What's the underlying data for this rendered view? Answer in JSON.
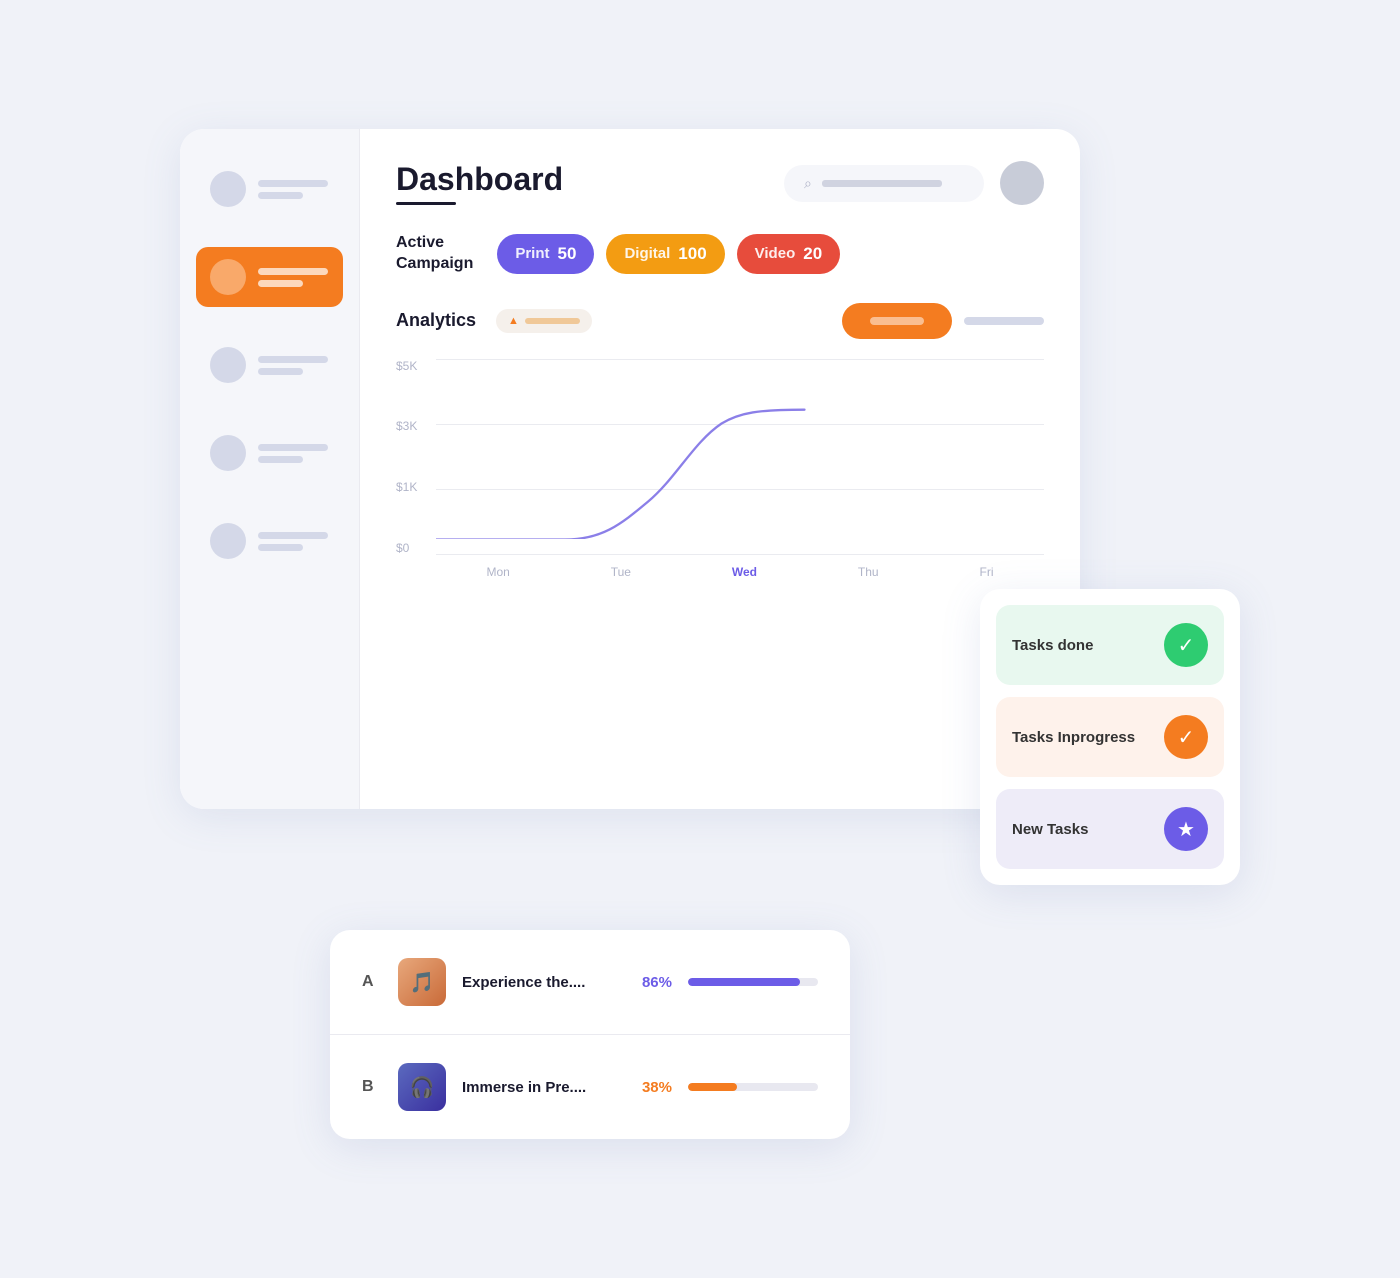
{
  "header": {
    "title": "Dashboard",
    "search_placeholder": "Search...",
    "underline": true
  },
  "sidebar": {
    "items": [
      {
        "id": "item-1",
        "active": false
      },
      {
        "id": "item-2",
        "active": true
      },
      {
        "id": "item-3",
        "active": false
      },
      {
        "id": "item-4",
        "active": false
      },
      {
        "id": "item-5",
        "active": false
      }
    ]
  },
  "campaign": {
    "label": "Active\nCampaign",
    "badges": [
      {
        "id": "print",
        "label": "Print",
        "value": "50",
        "color": "badge-print"
      },
      {
        "id": "digital",
        "label": "Digital",
        "value": "100",
        "color": "badge-digital"
      },
      {
        "id": "video",
        "label": "Video",
        "value": "20",
        "color": "badge-video"
      }
    ]
  },
  "analytics": {
    "title": "Analytics",
    "chart": {
      "y_labels": [
        "$5K",
        "$3K",
        "$1K",
        "$0"
      ],
      "x_labels": [
        "Mon",
        "Tue",
        "Wed",
        "Thu",
        "Fri"
      ],
      "active_day": "Wed"
    }
  },
  "list": {
    "items": [
      {
        "letter": "A",
        "title": "Experience the....",
        "percent": "86%",
        "percent_color": "pct-blue",
        "fill_color": "fill-blue",
        "fill_width": "86"
      },
      {
        "letter": "B",
        "title": "Immerse in Pre....",
        "percent": "38%",
        "percent_color": "pct-orange",
        "fill_color": "fill-orange",
        "fill_width": "38"
      }
    ]
  },
  "tasks": {
    "items": [
      {
        "id": "done",
        "label": "Tasks done",
        "icon": "✓",
        "icon_class": "icon-green",
        "bg": "task-item-done"
      },
      {
        "id": "inprogress",
        "label": "Tasks Inprogress",
        "icon": "✓",
        "icon_class": "icon-orange",
        "bg": "task-item-inprogress"
      },
      {
        "id": "new",
        "label": "New Tasks",
        "icon": "★",
        "icon_class": "icon-purple",
        "bg": "task-item-new"
      }
    ]
  },
  "colors": {
    "active_sidebar": "#f47c20",
    "print_badge": "#6c5ce7",
    "digital_badge": "#f39c12",
    "video_badge": "#e74c3c",
    "chart_line": "#8b7fe8"
  }
}
